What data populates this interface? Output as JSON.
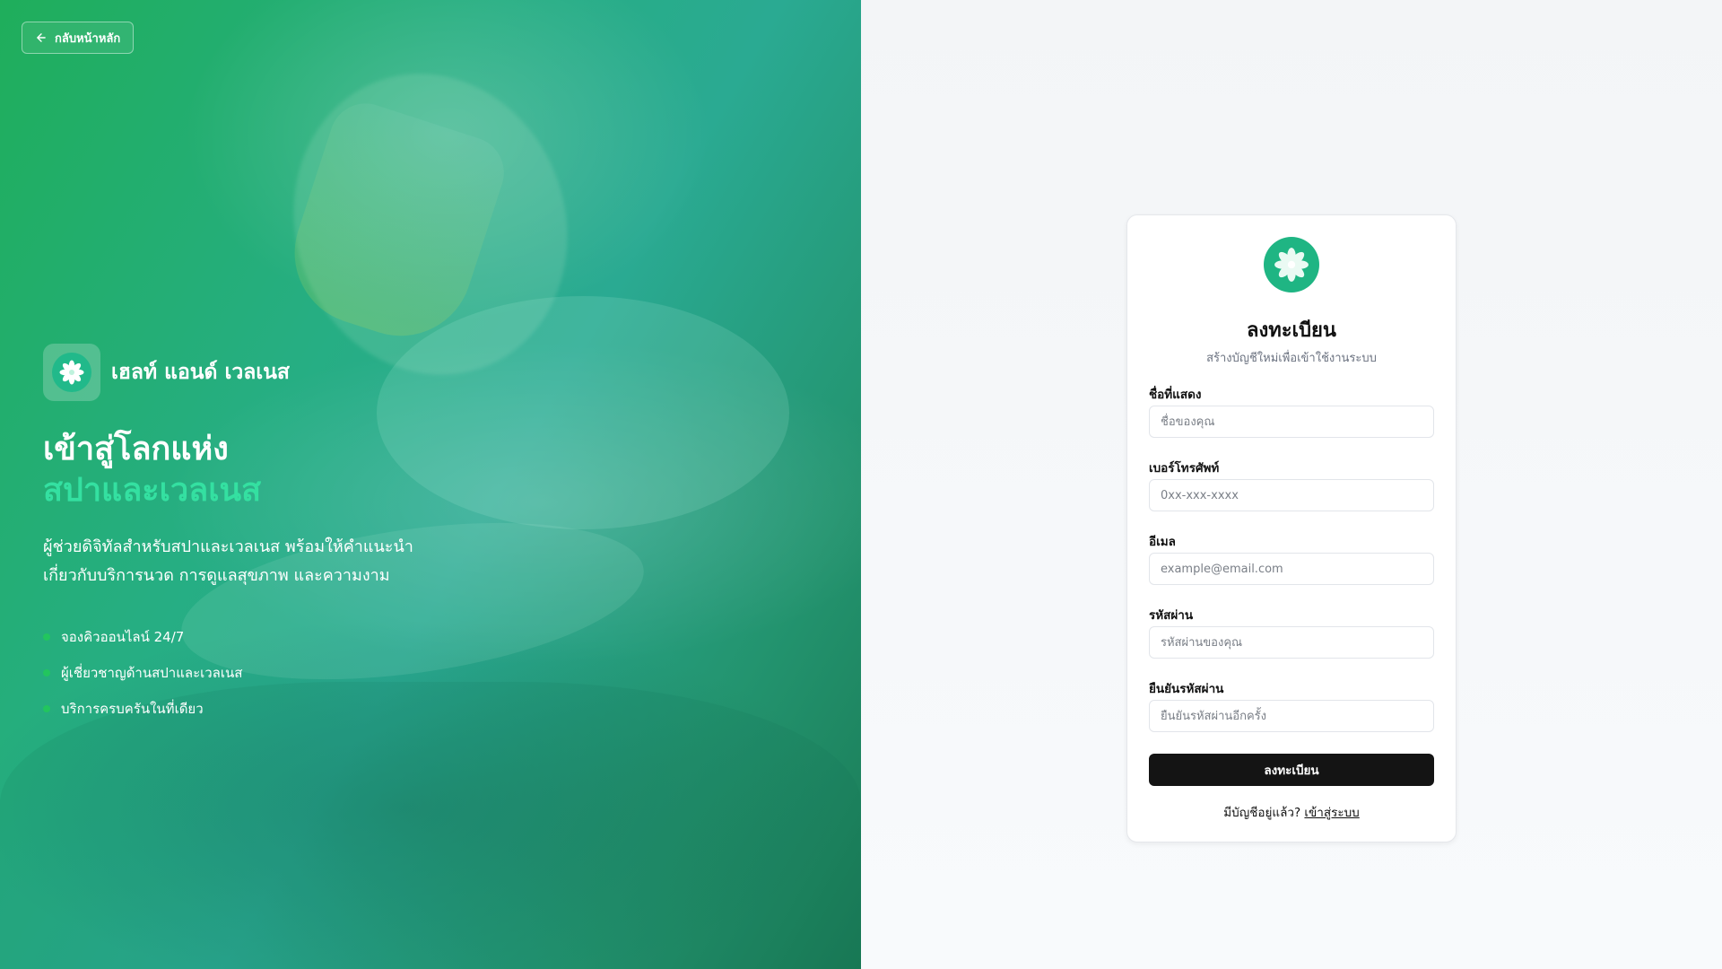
{
  "hero": {
    "back_button_label": "กลับหน้าหลัก",
    "brand_name": "เฮลท์ แอนด์ เวลเนส",
    "headline_line1": "เข้าสู่โลกแห่ง",
    "headline_line2": "สปาและเวลเนส",
    "description_line1": "ผู้ช่วยดิจิทัลสำหรับสปาและเวลเนส พร้อมให้คำแนะนำ",
    "description_line2": "เกี่ยวกับบริการนวด การดูแลสุขภาพ และความงาม",
    "features": [
      "จองคิวออนไลน์ 24/7",
      "ผู้เชี่ยวชาญด้านสปาและเวลเนส",
      "บริการครบครันในที่เดียว"
    ],
    "icons": {
      "back": "arrow-left-icon",
      "brand": "lotus-flower-icon"
    }
  },
  "form": {
    "title": "ลงทะเบียน",
    "subtitle": "สร้างบัญชีใหม่เพื่อเข้าใช้งานระบบ",
    "fields": [
      {
        "label": "ชื่อที่แสดง",
        "placeholder": "ชื่อของคุณ",
        "value": ""
      },
      {
        "label": "เบอร์โทรศัพท์",
        "placeholder": "0xx-xxx-xxxx",
        "value": ""
      },
      {
        "label": "อีเมล",
        "placeholder": "example@email.com",
        "value": ""
      },
      {
        "label": "รหัสผ่าน",
        "placeholder": "รหัสผ่านของคุณ",
        "value": ""
      },
      {
        "label": "ยืนยันรหัสผ่าน",
        "placeholder": "ยืนยันรหัสผ่านอีกครั้ง",
        "value": ""
      }
    ],
    "submit_label": "ลงทะเบียน",
    "have_account_text": "มีบัญชีอยู่แล้ว?",
    "login_link_label": "เข้าสู่ระบบ"
  },
  "colors": {
    "brand_green": "#1fb583",
    "accent_mint": "#34e0a1",
    "bullet_green": "#22c55e",
    "button_dark": "#141414"
  }
}
